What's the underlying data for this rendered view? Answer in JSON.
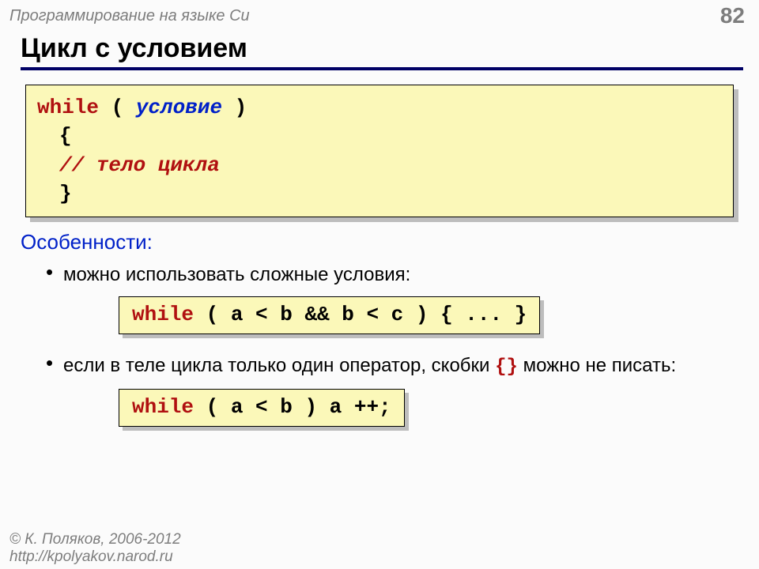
{
  "header": {
    "subject": "Программирование на языке Си",
    "page_number": "82"
  },
  "title": "Цикл с условием",
  "code_main": {
    "while": "while",
    "lparen": " ( ",
    "condition": "условие",
    "rparen": " )",
    "open_brace": "{",
    "body_comment": "// тело цикла",
    "close_brace": "}"
  },
  "features_heading": "Особенности:",
  "feature1": {
    "text": "можно использовать сложные условия:",
    "code_while": "while",
    "code_rest": " ( a < b && b < c ) { ... }"
  },
  "feature2": {
    "text_before": "если в теле цикла только один оператор, скобки ",
    "braces": "{}",
    "text_after": " можно не писать:",
    "code_while": "while",
    "code_rest": " ( a < b ) a ++;"
  },
  "footer": {
    "line1": "© К. Поляков, 2006-2012",
    "line2": "http://kpolyakov.narod.ru"
  }
}
